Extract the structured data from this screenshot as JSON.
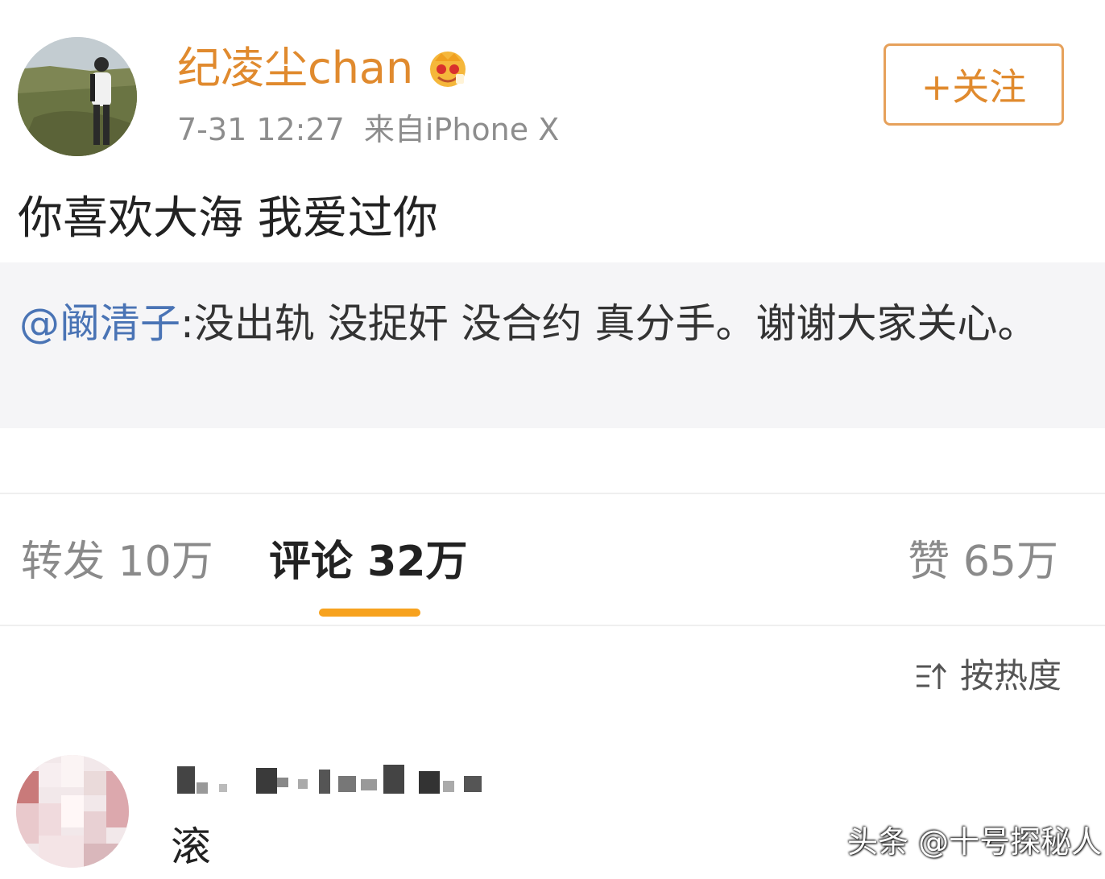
{
  "post": {
    "username": "纪凌尘chan",
    "time": "7-31 12:27",
    "source": "来自iPhone X",
    "follow_button": "+关注",
    "text": "你喜欢大海 我爱过你",
    "vip_icon": "vip-crown-icon"
  },
  "quote": {
    "mention": "@阚清子",
    "text": ":没出轨 没捉奸 没合约 真分手。谢谢大家关心。"
  },
  "tabs": {
    "repost": "转发 10万",
    "comment": "评论 32万",
    "like": "赞 65万"
  },
  "sort": {
    "label": "按热度",
    "icon": "sort-icon"
  },
  "comment": {
    "text": "滚",
    "username_blurred": true
  },
  "watermark": "头条 @十号探秘人",
  "colors": {
    "accent": "#e08a2e",
    "tab_underline": "#f7a21e",
    "mention": "#4a74b5",
    "quote_bg": "#f5f5f7"
  }
}
